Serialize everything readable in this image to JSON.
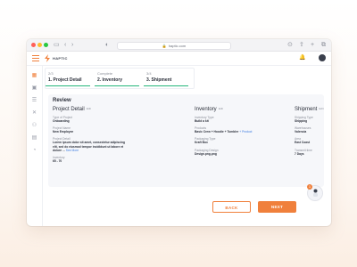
{
  "browser": {
    "url": "haptic.com",
    "nav_back_icon": "chevron-left-icon",
    "nav_forward_icon": "chevron-right-icon"
  },
  "app": {
    "brand": "HAPTIC",
    "accent_color": "#f0803c",
    "success_color": "#24b67a"
  },
  "steps": [
    {
      "num": "2/3",
      "title": "1. Project Detail"
    },
    {
      "num": "Complete",
      "title": "2. Inventory"
    },
    {
      "num": "3/4",
      "title": "3. Shipment"
    }
  ],
  "review": {
    "title": "Review",
    "edit_label": "Edit",
    "project": {
      "heading": "Project Detail",
      "fields": [
        {
          "label": "Type of Project",
          "value": "Onboarding"
        },
        {
          "label": "Project Name",
          "value": "New Employee"
        },
        {
          "label": "Project Detail",
          "value": "Lorem ipsum dolor sit amet, consectetur adipiscing elit, sed do eiusmod tempor incididunt ut labore et dolore ...",
          "more": "See More"
        },
        {
          "label": "Inventory",
          "value": "65 - 70"
        }
      ]
    },
    "inventory": {
      "heading": "Inventory",
      "fields": [
        {
          "label": "Inventory Type",
          "value": "Build a kit"
        },
        {
          "label": "Products",
          "value": "Basic Crew + Hoodie + Tumbler",
          "more": "+ Product"
        },
        {
          "label": "Packaging Type",
          "value": "Kraft Box"
        },
        {
          "label": "Packaging Design",
          "value": "Design.png.png"
        }
      ]
    },
    "shipment": {
      "heading": "Shipment",
      "fields": [
        {
          "label": "Shipping Type",
          "value": "Shipping"
        },
        {
          "label": "Warehouses",
          "value": "Valencia"
        },
        {
          "label": "Area",
          "value": "East Coast"
        },
        {
          "label": "Transmit time",
          "value": "7 Days"
        }
      ]
    }
  },
  "actions": {
    "back_label": "BACK",
    "next_label": "NEXT"
  },
  "help": {
    "badge_count": "1"
  }
}
